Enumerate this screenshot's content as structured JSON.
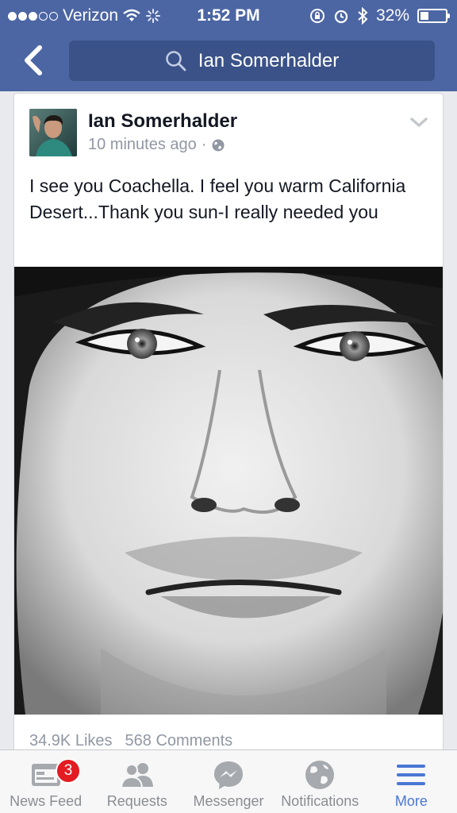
{
  "status_bar": {
    "carrier": "Verizon",
    "time": "1:52 PM",
    "battery": "32%",
    "battery_level": 0.32,
    "signal_bars": 3,
    "signal_total": 5
  },
  "nav": {
    "back_icon": "chevron-left-icon",
    "search_icon": "search-icon",
    "search_text": "Ian Somerhalder"
  },
  "post": {
    "author": "Ian Somerhalder",
    "time_ago": "10 minutes ago",
    "separator": "·",
    "privacy_icon": "globe-icon",
    "text": "I see you Coachella. I feel you warm California Desert...Thank you sun-I really needed you",
    "likes": "34.9K Likes",
    "comments": "568 Comments"
  },
  "tabbar": {
    "tabs": [
      {
        "label": "News Feed",
        "icon": "news-feed-icon",
        "badge": "3",
        "active": false
      },
      {
        "label": "Requests",
        "icon": "friends-icon",
        "active": false
      },
      {
        "label": "Messenger",
        "icon": "messenger-icon",
        "active": false
      },
      {
        "label": "Notifications",
        "icon": "globe-icon",
        "active": false
      },
      {
        "label": "More",
        "icon": "menu-icon",
        "active": true
      }
    ]
  },
  "colors": {
    "brand": "#4c66a4",
    "search_bg": "#3b5289",
    "active_tab": "#4a77d4",
    "badge": "#e31b23"
  }
}
